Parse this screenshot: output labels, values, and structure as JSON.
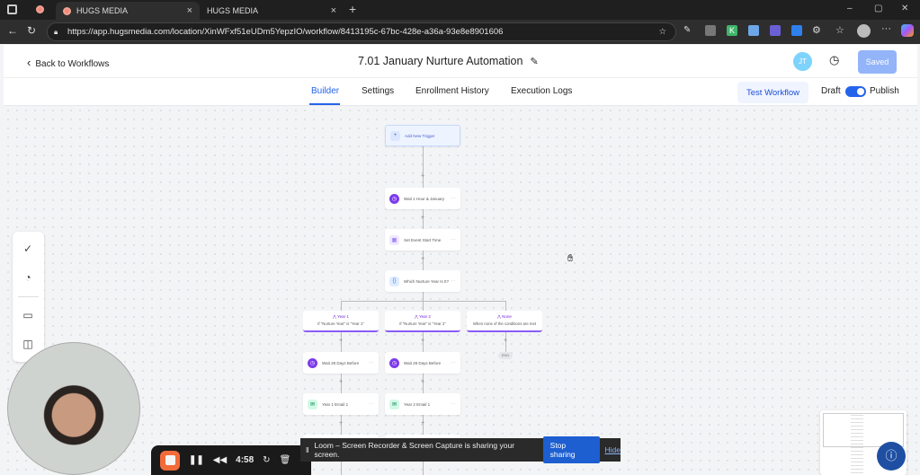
{
  "browser": {
    "tabs": [
      {
        "title": "HUGS MEDIA",
        "close": "×"
      },
      {
        "title": "HUGS MEDIA",
        "close": "×"
      }
    ],
    "new_tab": "+",
    "url": "https://app.hugsmedia.com/location/XinWFxf51eUDm5YepzIO/workflow/8413195c-67bc-428e-a36a-93e8e8901606",
    "extensions": [
      "K"
    ],
    "window_controls": [
      "–",
      "▢",
      "✕"
    ]
  },
  "header": {
    "back": "Back to Workflows",
    "title": "7.01 January Nurture Automation",
    "avatar": "JT",
    "saved": "Saved"
  },
  "nav": {
    "tabs": [
      "Builder",
      "Settings",
      "Enrollment History",
      "Execution Logs"
    ],
    "active": "Builder",
    "test": "Test Workflow",
    "draft": "Draft",
    "publish": "Publish",
    "toggle_on": true
  },
  "workflow": {
    "trigger": "Add New Trigger",
    "steps": [
      {
        "label": "Wait 1 Hour & January",
        "icon": "clock-icon",
        "color": "#7c3aed"
      },
      {
        "label": "Set Event Start Time",
        "icon": "calendar-icon",
        "color": "#8b5cf6"
      },
      {
        "label": "Which Nurture Year Is It?",
        "icon": "braces-icon",
        "color": "#3b82f6"
      }
    ],
    "branches": [
      {
        "title": "Year 1",
        "condition": "If \"Nurture Year\" is \"Year 1\"",
        "steps": [
          "Wait 28 Days Before",
          "Year 1 Email 1"
        ]
      },
      {
        "title": "Year 2",
        "condition": "If \"Nurture Year\" is \"Year 2\"",
        "steps": [
          "Wait 28 Days Before",
          "Year 2 Email 1"
        ]
      },
      {
        "title": "None",
        "condition": "When none of the conditions are met",
        "end": "END"
      }
    ]
  },
  "loom": {
    "message": "Loom – Screen Recorder & Screen Capture is sharing your screen.",
    "stop": "Stop sharing",
    "hide": "Hide",
    "timer": "4:58"
  },
  "colors": {
    "accent": "#2563eb",
    "branch": "#8b5cf6",
    "saved_bg": "#93b4f8"
  }
}
